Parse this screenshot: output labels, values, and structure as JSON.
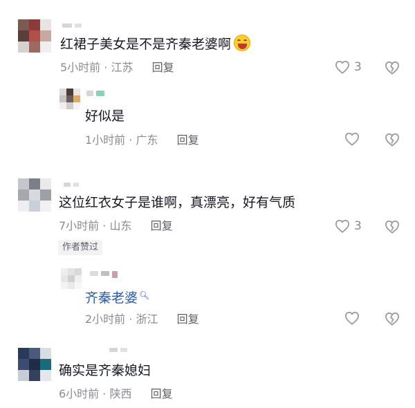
{
  "comments": [
    {
      "text": "红裙子美女是不是齐秦老婆啊",
      "emoji": "laughing-face",
      "time": "5小时前",
      "location": "江苏",
      "reply_label": "回复",
      "likes": "3"
    },
    {
      "text": "好似是",
      "time": "1小时前",
      "location": "广东",
      "reply_label": "回复"
    },
    {
      "text": "这位红衣女子是谁啊，真漂亮，好有气质",
      "time": "7小时前",
      "location": "山东",
      "reply_label": "回复",
      "likes": "3",
      "badge": "作者赞过"
    },
    {
      "text": "齐秦老婆",
      "time": "2小时前",
      "location": "浙江",
      "reply_label": "回复"
    },
    {
      "text": "确实是齐秦媳妇",
      "time": "6小时前",
      "location": "陕西",
      "reply_label": "回复"
    }
  ],
  "separator": "·",
  "colors": {
    "text": "#161823",
    "meta": "#8a8b91",
    "mention": "#2a5ba8",
    "icon": "#9b9ca3"
  },
  "icons": {
    "like": "heart-icon",
    "dislike": "broken-heart-icon",
    "mention_suffix": "search-icon"
  }
}
